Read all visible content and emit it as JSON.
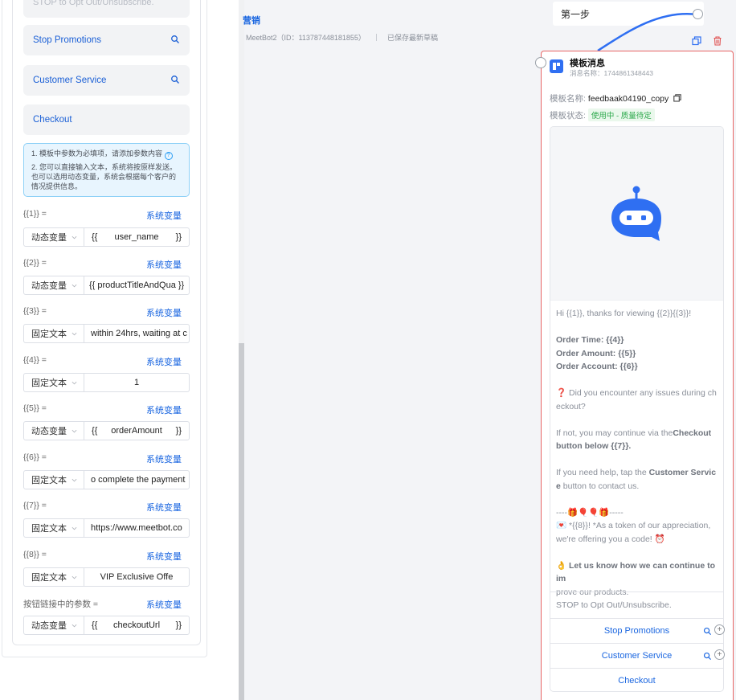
{
  "left": {
    "optout_button": "STOP to Opt Out/Unsubscribe.",
    "quick_buttons": [
      "Stop Promotions",
      "Customer Service",
      "Checkout"
    ],
    "tips": {
      "line1": "1. 模板中参数为必填项，请添加参数内容",
      "help": "?",
      "line2": "2. 您可以直接输入文本，系统将按原样发送。也可以选用动态变量，系统会根据每个客户的情况提供信息。"
    },
    "sys_var_label": "系统变量",
    "params": [
      {
        "label": "{{1}} =",
        "type": "动态变量",
        "value": "user_name"
      },
      {
        "label": "{{2}} =",
        "type": "动态变量",
        "value": "{{ productTitleAndQua }}"
      },
      {
        "label": "{{3}} =",
        "type": "固定文本",
        "value": "within 24hrs, waiting at c"
      },
      {
        "label": "{{4}} =",
        "type": "固定文本",
        "value": "1"
      },
      {
        "label": "{{5}} =",
        "type": "动态变量",
        "value": "orderAmount"
      },
      {
        "label": "{{6}} =",
        "type": "固定文本",
        "value": "o complete the payment"
      },
      {
        "label": "{{7}} =",
        "type": "固定文本",
        "value": "https://www.meetbot.co"
      },
      {
        "label": "{{8}} =",
        "type": "固定文本",
        "value": "VIP Exclusive Offe"
      },
      {
        "label": "按钮链接中的参数 =",
        "type": "动态变量",
        "value": "checkoutUrl"
      }
    ],
    "brace_left": "{{",
    "brace_right": "}}"
  },
  "canvas": {
    "title": "营销",
    "bot_info": "MeetBot2（ID：113787448181855）",
    "save_status": "已保存最新草稿",
    "step_label": "第一步",
    "connector_color": "#2f6ff2"
  },
  "card": {
    "title": "模板消息",
    "subtitle": "消息名称：1744861348443",
    "name_label": "模板名称:",
    "name_value": "feedbaak04190_copy",
    "status_label": "模板状态:",
    "status_value": "使用中 - 质量待定",
    "body": {
      "l1": "Hi {{1}}, thanks for viewing {{2}}{{3}}!",
      "l2": "Order Time: {{4}}",
      "l3": "Order Amount: {{5}}",
      "l4": "Order Account: {{6}}",
      "l5": "❓ Did you encounter any issues during ch",
      "l6": "eckout?",
      "l7a": "If not, you may continue via the",
      "l7b": "Checkout",
      "l8": "button below {{7}}.",
      "l9a": "If you need help, tap the ",
      "l9b": "Customer Servic",
      "l10a": "e",
      "l10b": " button to contact us.",
      "l11": "----🎁🎈🎈🎁-----",
      "l12a": "💌 *{{8}}! *",
      "l12b": "As a token of our appreciation,",
      "l13": "we're offering you a code! ⏰",
      "l14a": "👌 Let us know how we can continue to im",
      "l15": "prove our products."
    },
    "optout": "STOP to Opt Out/Unsubscribe.",
    "buttons": [
      "Stop Promotions",
      "Customer Service",
      "Checkout"
    ]
  }
}
